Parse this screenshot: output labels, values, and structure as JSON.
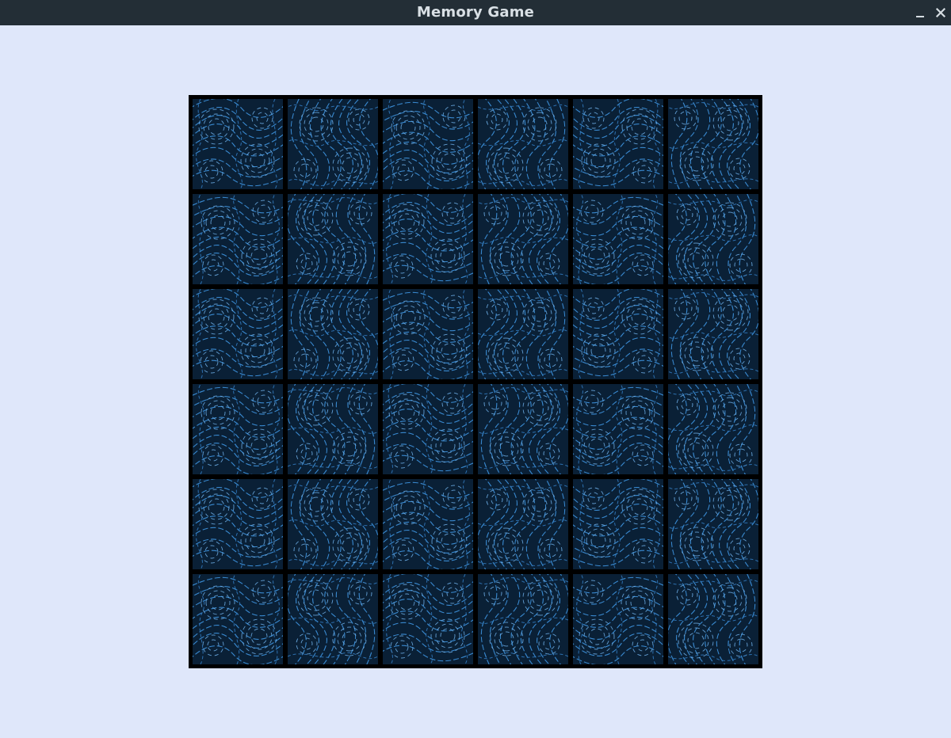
{
  "window": {
    "title": "Memory Game",
    "controls": {
      "minimize_icon": "minimize-icon",
      "close_icon": "close-icon"
    }
  },
  "theme": {
    "titlebar_bg": "#232e36",
    "client_bg": "#dfe7fa",
    "board_border": "#000000",
    "card_back_base": "#0a2036",
    "card_back_swirl": "#3a8ed8",
    "card_back_swirl_light": "#6fb2ec"
  },
  "board": {
    "rows": 6,
    "columns": 6,
    "cards": [
      {
        "state": "face-down"
      },
      {
        "state": "face-down"
      },
      {
        "state": "face-down"
      },
      {
        "state": "face-down"
      },
      {
        "state": "face-down"
      },
      {
        "state": "face-down"
      },
      {
        "state": "face-down"
      },
      {
        "state": "face-down"
      },
      {
        "state": "face-down"
      },
      {
        "state": "face-down"
      },
      {
        "state": "face-down"
      },
      {
        "state": "face-down"
      },
      {
        "state": "face-down"
      },
      {
        "state": "face-down"
      },
      {
        "state": "face-down"
      },
      {
        "state": "face-down"
      },
      {
        "state": "face-down"
      },
      {
        "state": "face-down"
      },
      {
        "state": "face-down"
      },
      {
        "state": "face-down"
      },
      {
        "state": "face-down"
      },
      {
        "state": "face-down"
      },
      {
        "state": "face-down"
      },
      {
        "state": "face-down"
      },
      {
        "state": "face-down"
      },
      {
        "state": "face-down"
      },
      {
        "state": "face-down"
      },
      {
        "state": "face-down"
      },
      {
        "state": "face-down"
      },
      {
        "state": "face-down"
      },
      {
        "state": "face-down"
      },
      {
        "state": "face-down"
      },
      {
        "state": "face-down"
      },
      {
        "state": "face-down"
      },
      {
        "state": "face-down"
      },
      {
        "state": "face-down"
      }
    ]
  }
}
